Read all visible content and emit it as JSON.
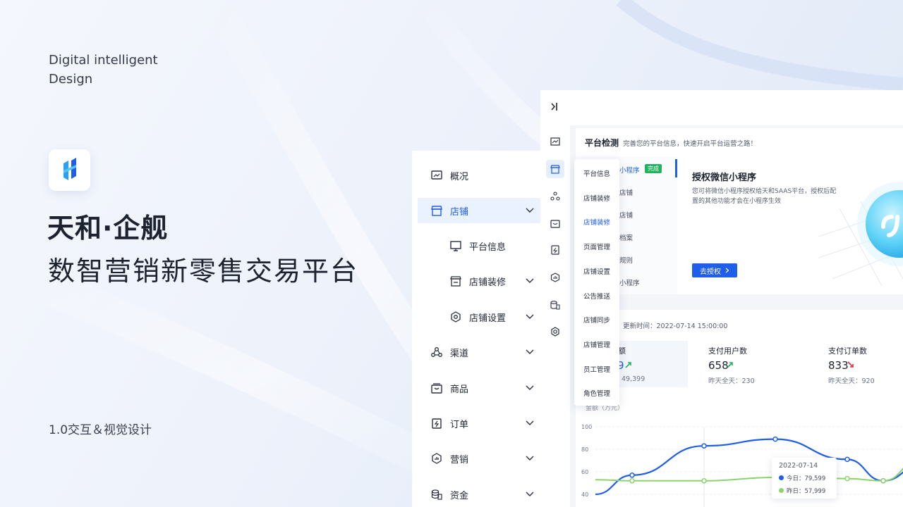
{
  "brand": {
    "tagline_1": "Digital intelligent",
    "tagline_2": "Design",
    "title": "天和·企舰",
    "subtitle": "数智营销新零售交易平台",
    "version": "1.0交互＆视觉设计"
  },
  "sidebar": {
    "items": [
      {
        "label": "概况",
        "icon": "overview-icon"
      },
      {
        "label": "店铺",
        "icon": "store-icon",
        "active": true
      },
      {
        "label": "平台信息",
        "icon": "monitor-icon"
      },
      {
        "label": "店铺装修",
        "icon": "decor-icon"
      },
      {
        "label": "店铺设置",
        "icon": "settings-hex-icon"
      },
      {
        "label": "渠道",
        "icon": "channel-icon"
      },
      {
        "label": "商品",
        "icon": "goods-icon"
      },
      {
        "label": "订单",
        "icon": "order-icon"
      },
      {
        "label": "营销",
        "icon": "marketing-icon"
      },
      {
        "label": "资金",
        "icon": "funds-icon"
      }
    ]
  },
  "dashboard": {
    "header_title": "平台检测",
    "header_desc": "完善您的平台信息，快速开启平台运营之路！",
    "steps": [
      {
        "label": "小程序",
        "badge": "完成"
      },
      {
        "label": "店铺"
      },
      {
        "label": "店铺"
      },
      {
        "label": "档案"
      },
      {
        "label": "规则"
      },
      {
        "label": "小程序"
      }
    ],
    "auth": {
      "title": "授权微信小程序",
      "desc_1": "您可将微信小程序授权给天和SAAS平台，授权后配",
      "desc_2": "置的其他功能才会在小程序生效",
      "button": "去授权"
    },
    "update_time": "更新时间：2022-07-14 15:00:00",
    "stats": [
      {
        "label": "额",
        "value": "9",
        "trend": "up",
        "yesterday": "49,399"
      },
      {
        "label": "支付用户数",
        "value": "658",
        "trend": "up",
        "yesterday": "昨天全天：230"
      },
      {
        "label": "支付订单数",
        "value": "833",
        "trend": "down",
        "yesterday": "昨天全天：920"
      }
    ],
    "dropdown": [
      {
        "label": "平台信息"
      },
      {
        "label": "店铺装修"
      },
      {
        "label": "店铺装修",
        "active": true
      },
      {
        "label": "页面管理"
      },
      {
        "label": "店铺设置"
      },
      {
        "label": "公告推送"
      },
      {
        "label": "店铺同步"
      },
      {
        "label": "店铺管理"
      },
      {
        "label": "员工管理"
      },
      {
        "label": "角色管理"
      }
    ],
    "chart_unit": "金额（万元）"
  },
  "colors": {
    "accent": "#1f5eea",
    "success": "#22b35e",
    "danger": "#e0303b",
    "series_today": "#1f5eea",
    "series_yesterday": "#8bd46b"
  },
  "chart_data": {
    "type": "line",
    "yticks": [
      "100",
      "80",
      "60",
      "40"
    ],
    "ylim": [
      40,
      100
    ],
    "series": [
      {
        "name": "今日",
        "values": [
          40,
          57,
          83,
          89,
          71,
          52,
          66
        ]
      },
      {
        "name": "昨日",
        "values": [
          53,
          52,
          52,
          55,
          54,
          52,
          72
        ]
      }
    ],
    "tooltip": {
      "date": "2022-07-14",
      "today": "今日：79,599",
      "yesterday": "昨日：57,999"
    }
  }
}
